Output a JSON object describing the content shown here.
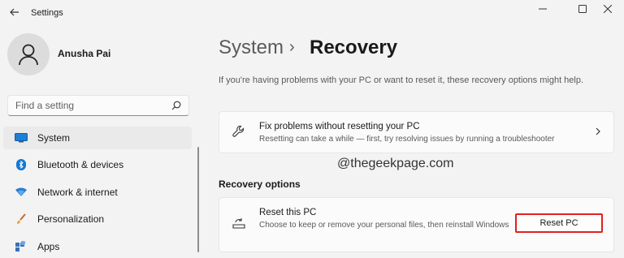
{
  "window": {
    "title": "Settings",
    "minimize_icon": "minimize-icon",
    "maximize_icon": "maximize-icon",
    "close_icon": "close-icon"
  },
  "profile": {
    "name": "Anusha Pai"
  },
  "search": {
    "placeholder": "Find a setting"
  },
  "sidebar": {
    "items": [
      {
        "label": "System",
        "icon": "system-icon",
        "active": true
      },
      {
        "label": "Bluetooth & devices",
        "icon": "bluetooth-icon"
      },
      {
        "label": "Network & internet",
        "icon": "network-icon"
      },
      {
        "label": "Personalization",
        "icon": "brush-icon"
      },
      {
        "label": "Apps",
        "icon": "apps-icon"
      }
    ]
  },
  "main": {
    "breadcrumb_parent": "System",
    "breadcrumb_separator": "›",
    "title": "Recovery",
    "intro": "If you're having problems with your PC or want to reset it, these recovery options might help.",
    "fix_card": {
      "title": "Fix problems without resetting your PC",
      "description": "Resetting can take a while — first, try resolving issues by running a troubleshooter"
    },
    "watermark": "@thegeekpage.com",
    "section_title": "Recovery options",
    "reset_card": {
      "title": "Reset this PC",
      "description": "Choose to keep or remove your personal files, then reinstall Windows",
      "button_label": "Reset PC"
    }
  },
  "colors": {
    "accent": "#0067c0",
    "highlight": "#e02020",
    "background": "#f3f3f3"
  }
}
